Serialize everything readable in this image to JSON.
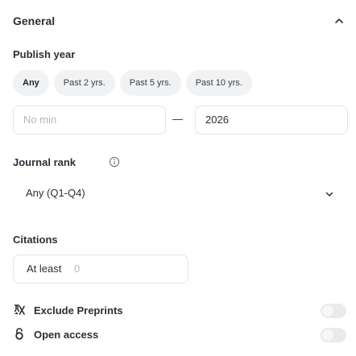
{
  "general": {
    "title": "General"
  },
  "publish_year": {
    "label": "Publish year",
    "chips": [
      {
        "label": "Any",
        "active": true
      },
      {
        "label": "Past 2 yrs.",
        "active": false
      },
      {
        "label": "Past 5 yrs.",
        "active": false
      },
      {
        "label": "Past 10 yrs.",
        "active": false
      }
    ],
    "min_placeholder": "No min",
    "separator": "—",
    "max_value": "2026"
  },
  "journal_rank": {
    "label": "Journal rank",
    "selected": "Any (Q1-Q4)",
    "info_icon": "info-icon"
  },
  "citations": {
    "label": "Citations",
    "prefix": "At least",
    "placeholder": "0"
  },
  "toggles": [
    {
      "label": "Exclude Preprints",
      "icon": "preprint-icon",
      "on": false
    },
    {
      "label": "Open access",
      "icon": "lock-open-icon",
      "on": false
    }
  ]
}
